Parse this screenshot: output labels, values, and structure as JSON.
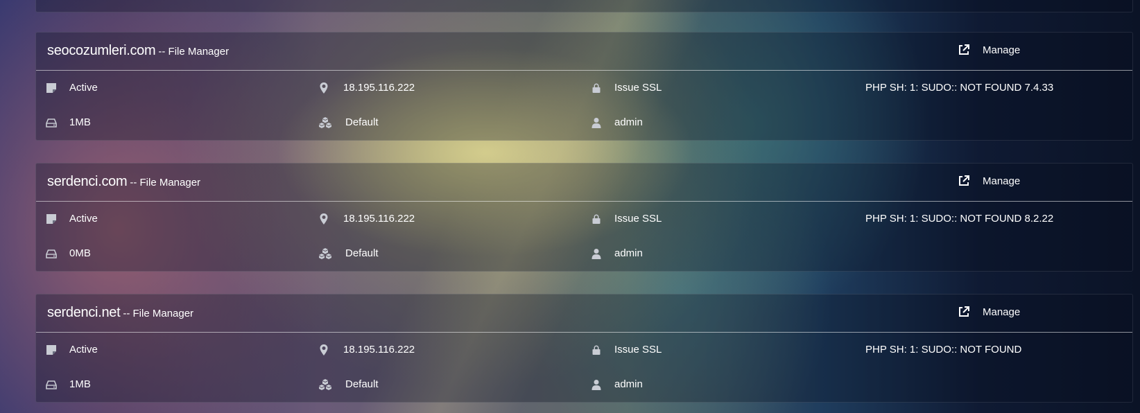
{
  "sites": [
    {
      "domain": "seocozumleri.com",
      "subtitle": "-- File Manager",
      "manage_label": "Manage",
      "status": "Active",
      "ip": "18.195.116.222",
      "ssl": "Issue SSL",
      "php": "PHP SH: 1: SUDO:: NOT FOUND 7.4.33",
      "disk": "1MB",
      "package": "Default",
      "owner": "admin"
    },
    {
      "domain": "serdenci.com",
      "subtitle": "-- File Manager",
      "manage_label": "Manage",
      "status": "Active",
      "ip": "18.195.116.222",
      "ssl": "Issue SSL",
      "php": "PHP SH: 1: SUDO:: NOT FOUND 8.2.22",
      "disk": "0MB",
      "package": "Default",
      "owner": "admin"
    },
    {
      "domain": "serdenci.net",
      "subtitle": "-- File Manager",
      "manage_label": "Manage",
      "status": "Active",
      "ip": "18.195.116.222",
      "ssl": "Issue SSL",
      "php": "PHP SH: 1: SUDO:: NOT FOUND",
      "disk": "1MB",
      "package": "Default",
      "owner": "admin"
    }
  ],
  "icons": {
    "status": "note-icon",
    "ip": "map-marker-icon",
    "ssl": "lock-icon",
    "disk": "hard-drive-icon",
    "package": "cubes-icon",
    "owner": "user-icon",
    "manage": "external-link-icon"
  }
}
